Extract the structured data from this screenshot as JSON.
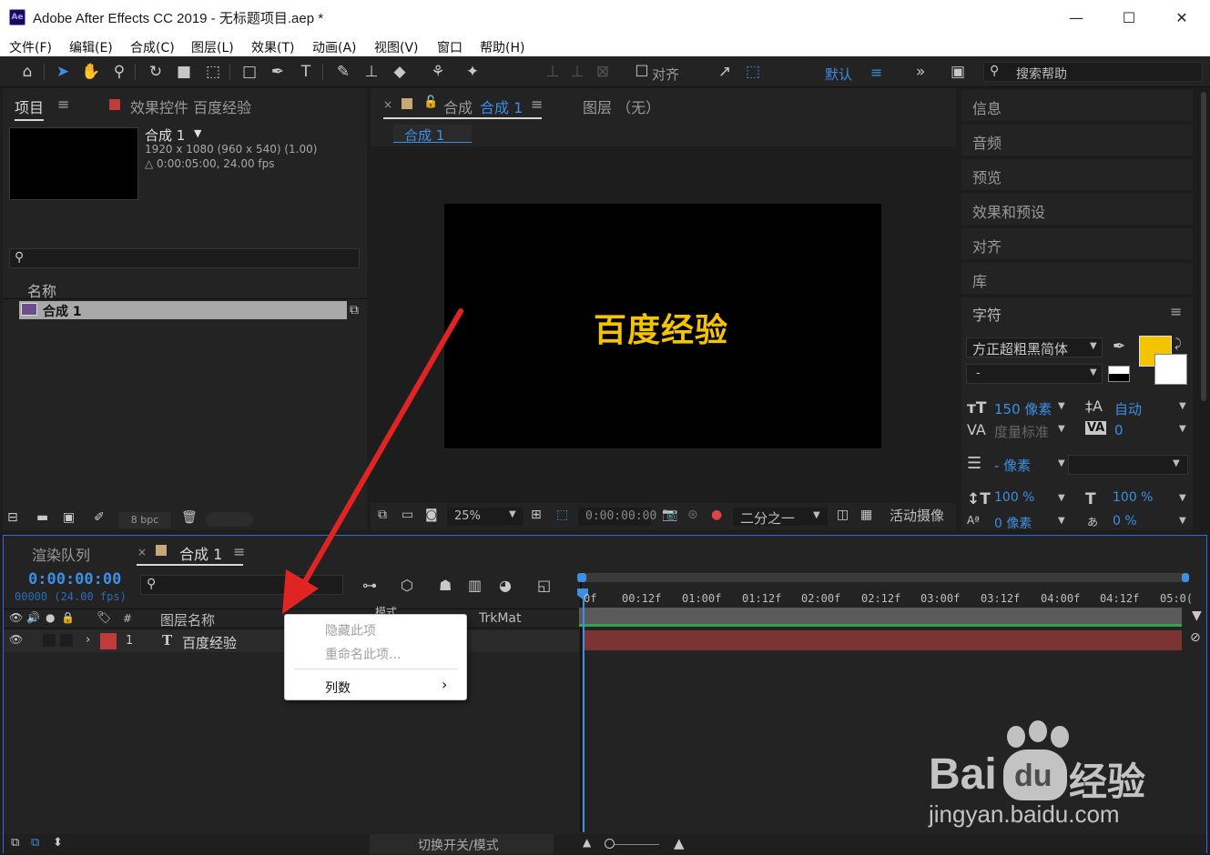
{
  "window": {
    "title": "Adobe After Effects CC 2019 - 无标题项目.aep *",
    "logo": "Ae",
    "buttons": {
      "minimize": "—",
      "maximize": "☐",
      "close": "✕"
    }
  },
  "menu": [
    "文件(F)",
    "编辑(E)",
    "合成(C)",
    "图层(L)",
    "效果(T)",
    "动画(A)",
    "视图(V)",
    "窗口",
    "帮助(H)"
  ],
  "toolbar": {
    "align_label": "对齐",
    "workspace": "默认",
    "search_placeholder": "搜索帮助"
  },
  "project": {
    "tab": "项目",
    "effects_tab": "效果控件 百度经验",
    "comp_name": "合成 1",
    "comp_dims": "1920 x 1080  (960 x 540) (1.00)",
    "comp_duration": "△ 0:00:05:00, 24.00 fps",
    "column_name": "名称",
    "item_name": "合成 1",
    "bpc": "8 bpc"
  },
  "viewer": {
    "tab_prefix": "合成",
    "tab_comp": "合成 1",
    "layer_tab": "图层 （无）",
    "breadcrumb": "合成 1",
    "canvas_text": "百度经验",
    "canvas_text_color": "#f5c400",
    "zoom": "25%",
    "timecode": "0:00:00:00",
    "resolution": "二分之一",
    "camera": "活动摄像"
  },
  "right_panels": {
    "items": [
      "信息",
      "音频",
      "预览",
      "效果和预设",
      "对齐",
      "库"
    ],
    "character_tab": "字符",
    "font_family": "方正超粗黑简体",
    "font_style": "-",
    "font_size": "150 像素",
    "leading": "自动",
    "kerning": "度量标准",
    "tracking": "0",
    "stroke_width": "- 像素",
    "vert_scale": "100 %",
    "horiz_scale": "100 %",
    "baseline": "0 像素",
    "tsume": "0 %",
    "fill_color": "#f5c400"
  },
  "timeline": {
    "render_tab": "渲染队列",
    "comp_tab": "合成 1",
    "timecode": "0:00:00:00",
    "frames": "00000  (24.00 fps)",
    "col_hash": "#",
    "col_layer_name": "图层名称",
    "col_mode": "模式",
    "col_trkmat": "TrkMat",
    "layer_index": "1",
    "layer_name": "百度经验",
    "layer_type": "T",
    "ruler": [
      "0f",
      "00:12f",
      "01:00f",
      "01:12f",
      "02:00f",
      "02:12f",
      "03:00f",
      "03:12f",
      "04:00f",
      "04:12f",
      "05:0("
    ],
    "footer": "切换开关/模式"
  },
  "context_menu": {
    "items": [
      {
        "label": "隐藏此项",
        "disabled": true
      },
      {
        "label": "重命名此项...",
        "disabled": true
      },
      {
        "label": "列数",
        "disabled": false,
        "submenu": true
      }
    ]
  },
  "watermark": {
    "brand": "Bai",
    "brand2": "du",
    "brand3": "经验",
    "url": "jingyan.baidu.com"
  },
  "colors": {
    "accent_blue": "#3d8fe4",
    "layer_label": "#c23b3b",
    "layer_bar": "#7a3434",
    "arrow": "#e02424"
  }
}
